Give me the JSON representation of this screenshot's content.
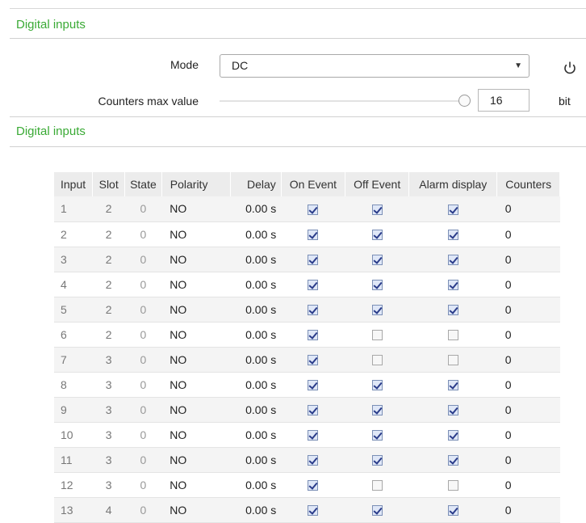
{
  "sections": {
    "header_top": "Digital inputs",
    "header_table": "Digital inputs"
  },
  "settings": {
    "mode_label": "Mode",
    "mode_value": "DC",
    "counters_label": "Counters max value",
    "counters_value": "16",
    "counters_unit": "bit"
  },
  "icons": {
    "reset": "power-icon",
    "dropdown": "chevron-down-icon"
  },
  "colors": {
    "accent_green": "#3aaa35",
    "checkbox_checked": "#2a3c8a"
  },
  "table": {
    "headers": {
      "input": "Input",
      "slot": "Slot",
      "state": "State",
      "polarity": "Polarity",
      "delay": "Delay",
      "on_event": "On Event",
      "off_event": "Off Event",
      "alarm_display": "Alarm display",
      "counters": "Counters"
    },
    "rows": [
      {
        "input": "1",
        "slot": "2",
        "state": "0",
        "polarity": "NO",
        "delay": "0.00 s",
        "on_event": true,
        "off_event": true,
        "alarm_display": true,
        "counters": "0"
      },
      {
        "input": "2",
        "slot": "2",
        "state": "0",
        "polarity": "NO",
        "delay": "0.00 s",
        "on_event": true,
        "off_event": true,
        "alarm_display": true,
        "counters": "0"
      },
      {
        "input": "3",
        "slot": "2",
        "state": "0",
        "polarity": "NO",
        "delay": "0.00 s",
        "on_event": true,
        "off_event": true,
        "alarm_display": true,
        "counters": "0"
      },
      {
        "input": "4",
        "slot": "2",
        "state": "0",
        "polarity": "NO",
        "delay": "0.00 s",
        "on_event": true,
        "off_event": true,
        "alarm_display": true,
        "counters": "0"
      },
      {
        "input": "5",
        "slot": "2",
        "state": "0",
        "polarity": "NO",
        "delay": "0.00 s",
        "on_event": true,
        "off_event": true,
        "alarm_display": true,
        "counters": "0"
      },
      {
        "input": "6",
        "slot": "2",
        "state": "0",
        "polarity": "NO",
        "delay": "0.00 s",
        "on_event": true,
        "off_event": false,
        "alarm_display": false,
        "counters": "0"
      },
      {
        "input": "7",
        "slot": "3",
        "state": "0",
        "polarity": "NO",
        "delay": "0.00 s",
        "on_event": true,
        "off_event": false,
        "alarm_display": false,
        "counters": "0"
      },
      {
        "input": "8",
        "slot": "3",
        "state": "0",
        "polarity": "NO",
        "delay": "0.00 s",
        "on_event": true,
        "off_event": true,
        "alarm_display": true,
        "counters": "0"
      },
      {
        "input": "9",
        "slot": "3",
        "state": "0",
        "polarity": "NO",
        "delay": "0.00 s",
        "on_event": true,
        "off_event": true,
        "alarm_display": true,
        "counters": "0"
      },
      {
        "input": "10",
        "slot": "3",
        "state": "0",
        "polarity": "NO",
        "delay": "0.00 s",
        "on_event": true,
        "off_event": true,
        "alarm_display": true,
        "counters": "0"
      },
      {
        "input": "11",
        "slot": "3",
        "state": "0",
        "polarity": "NO",
        "delay": "0.00 s",
        "on_event": true,
        "off_event": true,
        "alarm_display": true,
        "counters": "0"
      },
      {
        "input": "12",
        "slot": "3",
        "state": "0",
        "polarity": "NO",
        "delay": "0.00 s",
        "on_event": true,
        "off_event": false,
        "alarm_display": false,
        "counters": "0"
      },
      {
        "input": "13",
        "slot": "4",
        "state": "0",
        "polarity": "NO",
        "delay": "0.00 s",
        "on_event": true,
        "off_event": true,
        "alarm_display": true,
        "counters": "0"
      }
    ]
  }
}
